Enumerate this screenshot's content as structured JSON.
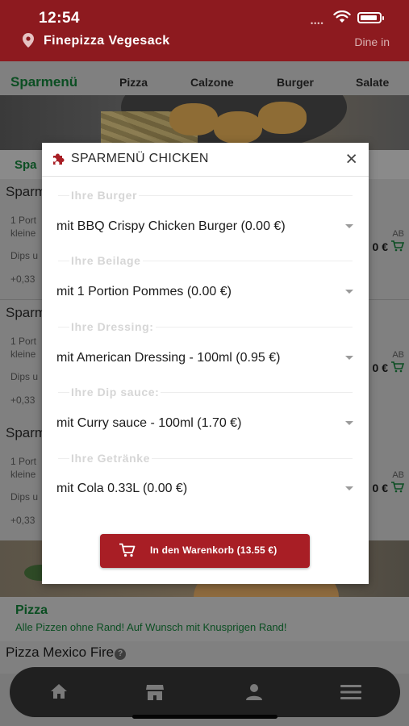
{
  "status_bar": {
    "time": "12:54",
    "signal": "••••"
  },
  "header": {
    "store_name": "Finepizza Vegesack",
    "mode": "Dine in"
  },
  "tabs": [
    {
      "label": "Sparmenü",
      "active": true
    },
    {
      "label": "Pizza"
    },
    {
      "label": "Calzone"
    },
    {
      "label": "Burger"
    },
    {
      "label": "Salate"
    }
  ],
  "section_title": "Spa",
  "menu_items": [
    {
      "name": "Sparm",
      "line1": "1 Port",
      "line2": "kleine",
      "line3": "Dips u",
      "line4": "+0,33",
      "ab": "AB",
      "price": "0 €"
    },
    {
      "name": "Sparm",
      "line1": "1 Port",
      "line2": "kleine",
      "line3": "Dips u",
      "line4": "+0,33",
      "ab": "AB",
      "price": "0 €"
    },
    {
      "name": "Sparm",
      "line1": "1 Port",
      "line2": "kleine",
      "line3": "Dips u",
      "line4": "+0,33",
      "ab": "AB",
      "price": "0 €"
    }
  ],
  "pizza_section": {
    "title": "Pizza",
    "subtitle": "Alle Pizzen ohne Rand! Auf Wunsch mit Knusprigen Rand!",
    "first_item": "Pizza Mexico Fire",
    "help_glyph": "?"
  },
  "modal": {
    "title": "SPARMENÜ CHICKEN",
    "close_glyph": "×",
    "groups": [
      {
        "label": "Ihre Burger",
        "value": "mit BBQ Crispy Chicken Burger (0.00 €)"
      },
      {
        "label": "Ihre Beilage",
        "value": "mit 1 Portion Pommes (0.00 €)"
      },
      {
        "label": "Ihre Dressing:",
        "value": "mit American Dressing - 100ml (0.95 €)"
      },
      {
        "label": "Ihre Dip sauce:",
        "value": "mit Curry sauce - 100ml (1.70 €)"
      },
      {
        "label": "Ihre Getränke",
        "value": "mit Cola 0.33L (0.00 €)"
      }
    ],
    "cart_button_label": "In den Warenkorb (13.55 €)"
  },
  "bottom_nav": [
    "home-icon",
    "store-icon",
    "user-icon",
    "menu-icon"
  ],
  "colors": {
    "brand_red": "#a81e25",
    "header_red": "#8d1a1f",
    "accent_green": "#0b4e22",
    "nav_dark": "#202020"
  }
}
